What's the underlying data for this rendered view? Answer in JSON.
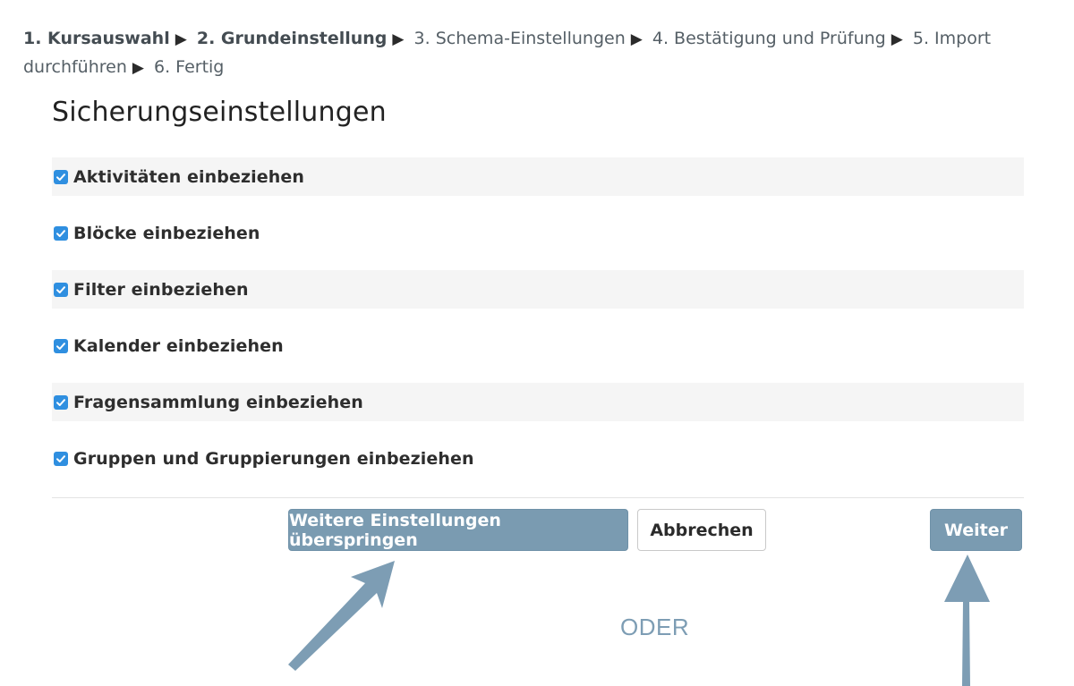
{
  "breadcrumb": {
    "steps": [
      {
        "label": "1. Kursauswahl",
        "done": true
      },
      {
        "label": "2. Grundeinstellung",
        "done": true
      },
      {
        "label": "3. Schema-Einstellungen",
        "done": false
      },
      {
        "label": "4. Bestätigung und Prüfung",
        "done": false
      },
      {
        "label": "5. Import durchführen",
        "done": false
      },
      {
        "label": "6. Fertig",
        "done": false
      }
    ],
    "separator": "▶"
  },
  "section": {
    "title": "Sicherungseinstellungen"
  },
  "settings": [
    {
      "label": "Aktivitäten einbeziehen",
      "checked": true
    },
    {
      "label": "Blöcke einbeziehen",
      "checked": true
    },
    {
      "label": "Filter einbeziehen",
      "checked": true
    },
    {
      "label": "Kalender einbeziehen",
      "checked": true
    },
    {
      "label": "Fragensammlung einbeziehen",
      "checked": true
    },
    {
      "label": "Gruppen und Gruppierungen einbeziehen",
      "checked": true
    }
  ],
  "buttons": {
    "skip_label": "Weitere Einstellungen überspringen",
    "cancel_label": "Abbrechen",
    "next_label": "Weiter"
  },
  "annotation": {
    "or_label": "ODER"
  },
  "colors": {
    "primary_button": "#7a9bb1",
    "checkbox": "#2f8fe0",
    "annotation_arrow": "#7d9db4"
  }
}
